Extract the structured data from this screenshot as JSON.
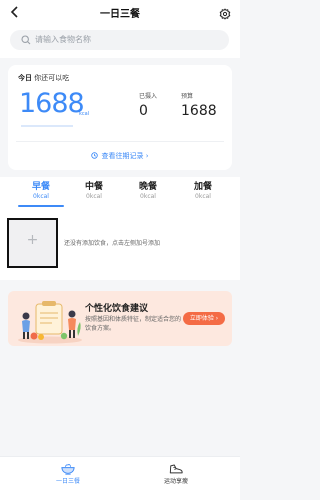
{
  "header": {
    "back_icon": "chevron-left-icon",
    "title": "一日三餐",
    "settings_icon": "gear-icon"
  },
  "search": {
    "placeholder": "请输入食物名称",
    "icon": "search-icon"
  },
  "summary": {
    "today_label": "今日",
    "can_eat_label": "你还可以吃",
    "remaining": "1688",
    "remaining_unit": "kcal",
    "eaten_label": "已摄入",
    "eaten_value": "0",
    "budget_label": "预算",
    "budget_value": "1688",
    "history_link": "查看往期记录",
    "history_arrow": "›"
  },
  "meals": {
    "active_index": 0,
    "tabs": [
      {
        "name": "早餐",
        "calories": "0kcal"
      },
      {
        "name": "中餐",
        "calories": "0kcal"
      },
      {
        "name": "晚餐",
        "calories": "0kcal"
      },
      {
        "name": "加餐",
        "calories": "0kcal"
      }
    ]
  },
  "food": {
    "add_symbol": "+",
    "empty_tip": "还没有添加饮食，点击左侧加号添加"
  },
  "promo": {
    "title": "个性化饮食建议",
    "description": "按照基因和体质特征，制定适合您的饮食方案。",
    "button": "立即体验 ›"
  },
  "bottom_nav": {
    "items": [
      {
        "label": "一日三餐",
        "icon": "meal-bowl-icon",
        "active": true
      },
      {
        "label": "运动享瘦",
        "icon": "sneaker-icon",
        "active": false
      }
    ]
  },
  "colors": {
    "accent": "#3d8af7",
    "promo_bg": "#fde8df",
    "promo_button": "#f46b45",
    "page_bg": "#f5f6f8"
  }
}
